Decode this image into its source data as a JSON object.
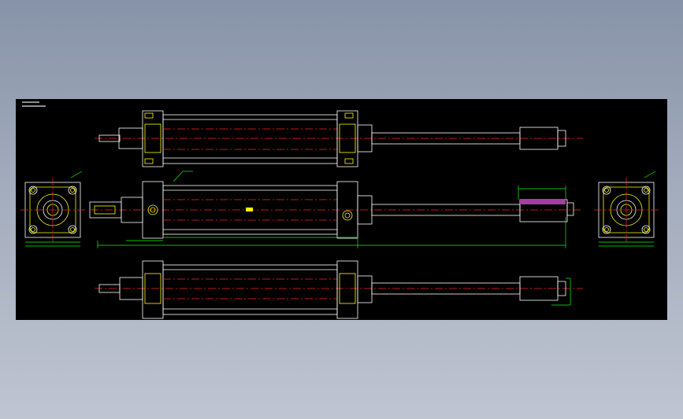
{
  "title_block": {
    "line1": "",
    "line2": ""
  },
  "colors": {
    "background": "#000000",
    "outline": "#ffffff",
    "hidden": "#ffff00",
    "dimension": "#00ff00",
    "centerline": "#ff2020",
    "hatch": "#a040a0"
  },
  "views": [
    "top-view",
    "front-view",
    "bottom-view",
    "left-end-view",
    "right-end-view"
  ]
}
